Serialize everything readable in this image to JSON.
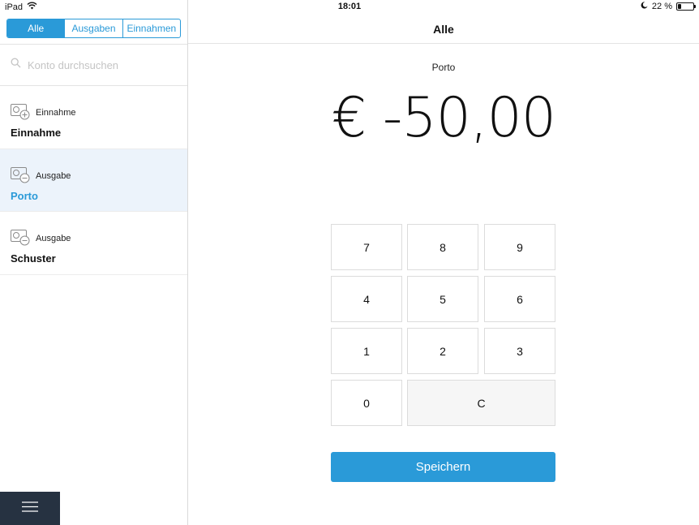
{
  "status_bar": {
    "device": "iPad",
    "time": "18:01",
    "battery_text": "22 %",
    "battery_level": 0.22
  },
  "sidebar": {
    "filter_tabs": [
      {
        "label": "Alle",
        "active": true
      },
      {
        "label": "Ausgaben",
        "active": false
      },
      {
        "label": "Einnahmen",
        "active": false
      }
    ],
    "search": {
      "placeholder": "Konto durchsuchen"
    },
    "items": [
      {
        "type": "Einnahme",
        "name": "Einnahme",
        "icon": "income-icon",
        "selected": false
      },
      {
        "type": "Ausgabe",
        "name": "Porto",
        "icon": "expense-icon",
        "selected": true
      },
      {
        "type": "Ausgabe",
        "name": "Schuster",
        "icon": "expense-icon",
        "selected": false
      }
    ],
    "menu_icon": "hamburger-menu-icon"
  },
  "main": {
    "title": "Alle",
    "transaction_label": "Porto",
    "amount": "€ -50,00",
    "keypad": {
      "k7": "7",
      "k8": "8",
      "k9": "9",
      "k4": "4",
      "k5": "5",
      "k6": "6",
      "k1": "1",
      "k2": "2",
      "k3": "3",
      "k0": "0",
      "clear": "C"
    },
    "save_label": "Speichern"
  },
  "colors": {
    "accent": "#2a9ad8",
    "selected_bg": "#ecf3fb",
    "menu_bg": "#263241"
  }
}
